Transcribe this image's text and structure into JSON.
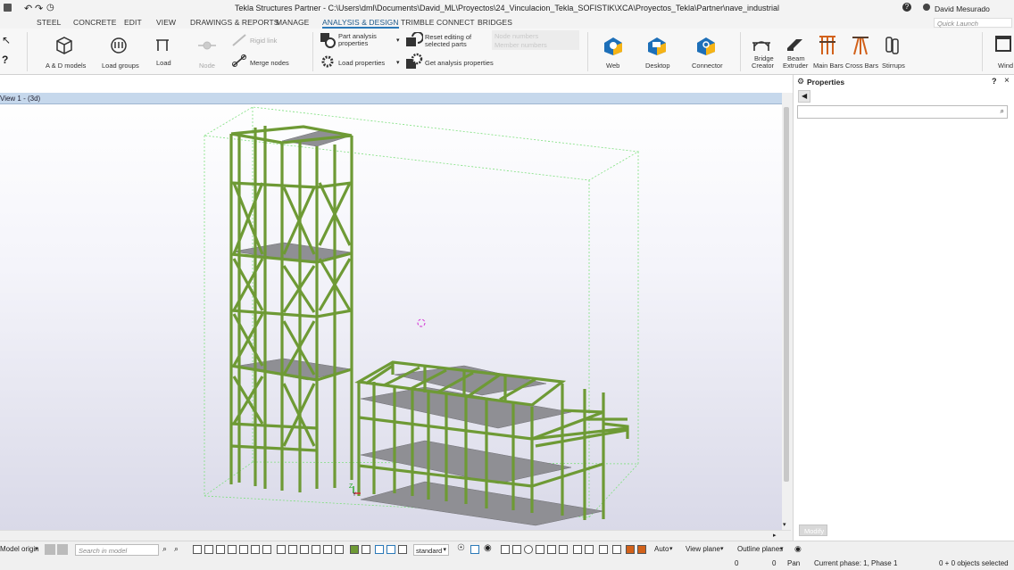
{
  "window": {
    "title": "Tekla Structures Partner - C:\\Users\\dml\\Documents\\David_ML\\Proyectos\\24_Vinculacion_Tekla_SOFISTIK\\XCA\\Proyectos_Tekla\\Partner\\nave_industrial",
    "user": "David Mesurado",
    "quick_launch_placeholder": "Quick Launch"
  },
  "menu": [
    "STEEL",
    "CONCRETE",
    "EDIT",
    "VIEW",
    "DRAWINGS & REPORTS",
    "MANAGE",
    "ANALYSIS & DESIGN",
    "TRIMBLE CONNECT",
    "BRIDGES"
  ],
  "ribbon": {
    "ad_models": "A & D models",
    "load_groups": "Load groups",
    "load": "Load",
    "node": "Node",
    "rigid_link": "Rigid link",
    "merge_nodes": "Merge nodes",
    "part_analysis_1": "Part analysis",
    "part_analysis_2": "properties",
    "load_properties": "Load properties",
    "reset_editing_1": "Reset editing of",
    "reset_editing_2": "selected parts",
    "get_analysis": "Get analysis properties",
    "node_numbers": "Node numbers",
    "member_numbers": "Member numbers",
    "web": "Web",
    "desktop": "Desktop",
    "connector": "Connector",
    "bridge_creator_1": "Bridge",
    "bridge_creator_2": "Creator",
    "beam_extruder_1": "Beam",
    "beam_extruder_2": "Extruder",
    "main_bars": "Main Bars",
    "cross_bars": "Cross Bars",
    "stirrups": "Stirrups",
    "windows": "Wind"
  },
  "view": {
    "title": "View 1 - (3d)"
  },
  "properties": {
    "title": "Properties",
    "modify_button": "Modify"
  },
  "toolbar": {
    "model_origin": "Model origin",
    "search_placeholder": "Search in model",
    "standard": "standard",
    "auto": "Auto",
    "view_plane": "View plane",
    "outline_planes": "Outline planes"
  },
  "status": {
    "x": "0",
    "y": "0",
    "mode": "Pan",
    "phase": "Current phase: 1, Phase 1",
    "selection": "0 + 0 objects selected"
  },
  "colors": {
    "accent": "#2b79b8",
    "steel": "#6e9a35",
    "slab": "#8f8f94"
  }
}
